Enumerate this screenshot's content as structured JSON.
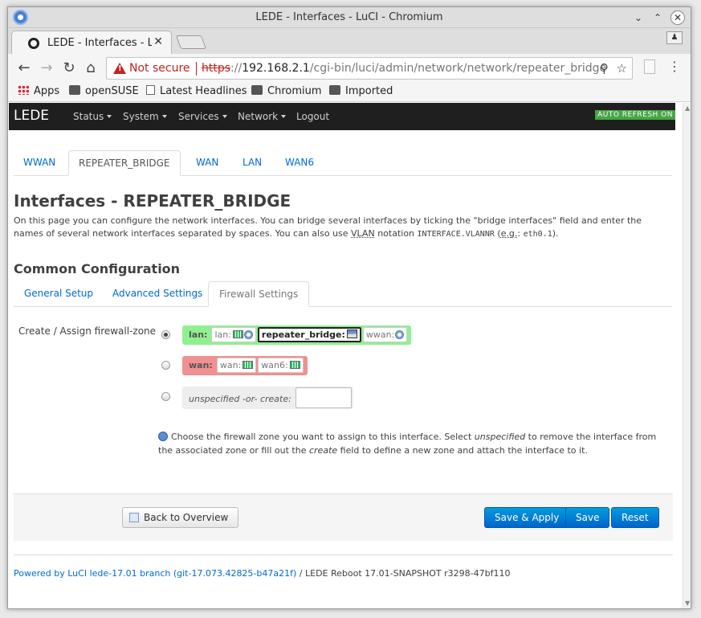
{
  "window": {
    "title": "LEDE - Interfaces - LuCI - Chromium"
  },
  "browser": {
    "tab_title": "LEDE - Interfaces - LuCI",
    "not_secure": "Not secure",
    "url_scheme": "https",
    "url_sep": "://",
    "url_host": "192.168.2.1",
    "url_path": "/cgi-bin/luci/admin/network/network/repeater_bridge",
    "bookmarks": [
      "Apps",
      "openSUSE",
      "Latest Headlines",
      "Chromium",
      "Imported"
    ]
  },
  "nav": {
    "brand": "LEDE",
    "items": [
      "Status",
      "System",
      "Services",
      "Network",
      "Logout"
    ],
    "autorefresh": "AUTO REFRESH ON"
  },
  "tabs": [
    "WWAN",
    "REPEATER_BRIDGE",
    "WAN",
    "LAN",
    "WAN6"
  ],
  "page": {
    "title": "Interfaces - REPEATER_BRIDGE",
    "desc_1": "On this page you can configure the network interfaces. You can bridge several interfaces by ticking the \"bridge interfaces\" field and enter the names of several network interfaces separated by spaces. You can also use ",
    "desc_vlan": "VLAN",
    "desc_2": " notation ",
    "desc_code1": "INTERFACE.VLANNR",
    "desc_3": " (",
    "desc_eg": "e.g.",
    "desc_4": ": ",
    "desc_code2": "eth0.1",
    "desc_5": ").",
    "section": "Common Configuration",
    "subtabs": [
      "General Setup",
      "Advanced Settings",
      "Firewall Settings"
    ],
    "field_label": "Create / Assign firewall-zone",
    "zone_lan": {
      "label": "lan:",
      "networks": [
        "lan:",
        "repeater_bridge:",
        "wwan:"
      ]
    },
    "zone_wan": {
      "label": "wan:",
      "networks": [
        "wan:",
        "wan6:"
      ]
    },
    "zone_unspec": {
      "label": "unspecified -or- create:",
      "input_value": ""
    },
    "hint_1": "Choose the firewall zone you want to assign to this interface. Select ",
    "hint_em1": "unspecified",
    "hint_2": " to remove the interface from the associated zone or fill out the ",
    "hint_em2": "create",
    "hint_3": " field to define a new zone and attach the interface to it.",
    "buttons": {
      "back": "Back to Overview",
      "save_apply": "Save & Apply",
      "save": "Save",
      "reset": "Reset"
    },
    "footer_link": "Powered by LuCI lede-17.01 branch (git-17.073.42825-b47a21f)",
    "footer_rest": " / LEDE Reboot 17.01-SNAPSHOT r3298-47bf110"
  },
  "colors": {
    "navbar": "#1f1f1f",
    "zone_lan": "#90f090",
    "zone_wan": "#f09090",
    "link": "#0069d6",
    "primary_button": "#0064cd",
    "autorefresh": "#46a546"
  }
}
